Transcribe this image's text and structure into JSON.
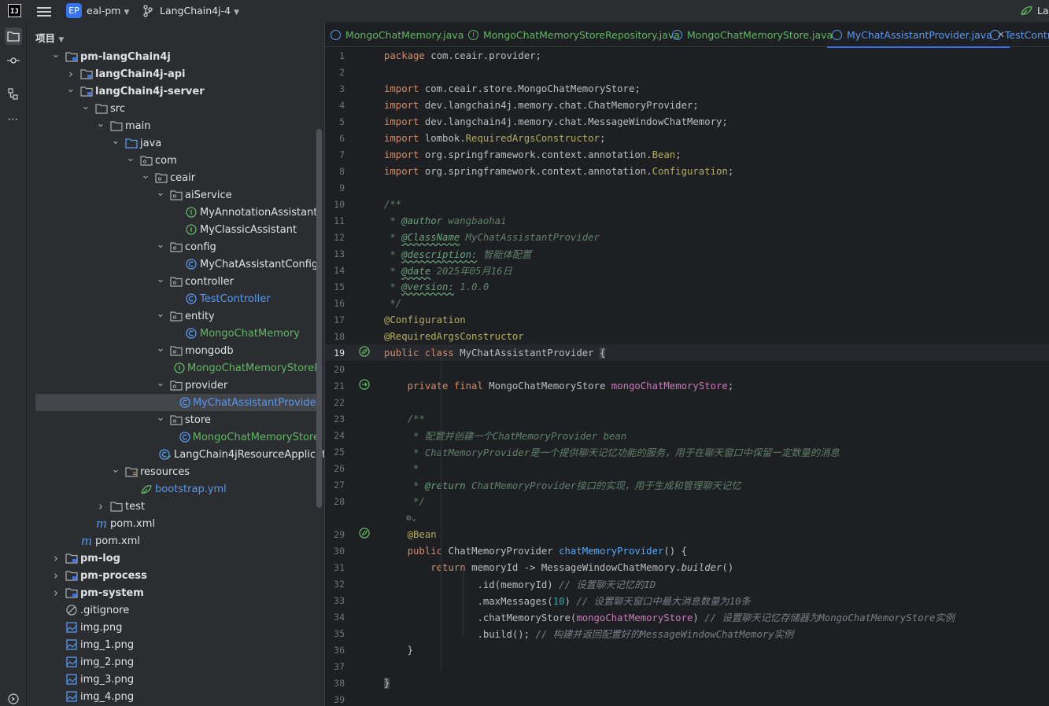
{
  "titlebar": {
    "logo": "IJ",
    "project_badge": "EP",
    "project_name": "eal-pm",
    "branch": "LangChain4j-4",
    "right_label": "Lar"
  },
  "project_panel": {
    "title": "项目",
    "tree": [
      {
        "label": "pm-langChain4j",
        "depth": 1,
        "chev": "down",
        "icon": "module-folder-icon",
        "bold": true
      },
      {
        "label": "langChain4j-api",
        "depth": 2,
        "chev": "right",
        "icon": "module-folder-icon",
        "bold": true
      },
      {
        "label": "langChain4j-server",
        "depth": 2,
        "chev": "down",
        "icon": "module-folder-icon",
        "bold": true
      },
      {
        "label": "src",
        "depth": 3,
        "chev": "down",
        "icon": "folder-icon"
      },
      {
        "label": "main",
        "depth": 4,
        "chev": "down",
        "icon": "folder-icon"
      },
      {
        "label": "java",
        "depth": 5,
        "chev": "down",
        "icon": "source-folder-icon"
      },
      {
        "label": "com",
        "depth": 6,
        "chev": "down",
        "icon": "package-icon"
      },
      {
        "label": "ceair",
        "depth": 7,
        "chev": "down",
        "icon": "package-icon"
      },
      {
        "label": "aiService",
        "depth": 8,
        "chev": "down",
        "icon": "package-icon"
      },
      {
        "label": "MyAnnotationAssistant",
        "depth": 9,
        "chev": "",
        "icon": "interface-icon"
      },
      {
        "label": "MyClassicAssistant",
        "depth": 9,
        "chev": "",
        "icon": "interface-icon"
      },
      {
        "label": "config",
        "depth": 8,
        "chev": "down",
        "icon": "package-icon"
      },
      {
        "label": "MyChatAssistantConfig",
        "depth": 9,
        "chev": "",
        "icon": "class-icon"
      },
      {
        "label": "controller",
        "depth": 8,
        "chev": "down",
        "icon": "package-icon"
      },
      {
        "label": "TestController",
        "depth": 9,
        "chev": "",
        "icon": "class-icon",
        "color": "blue"
      },
      {
        "label": "entity",
        "depth": 8,
        "chev": "down",
        "icon": "package-icon"
      },
      {
        "label": "MongoChatMemory",
        "depth": 9,
        "chev": "",
        "icon": "class-icon",
        "color": "green"
      },
      {
        "label": "mongodb",
        "depth": 8,
        "chev": "down",
        "icon": "package-icon"
      },
      {
        "label": "MongoChatMemoryStoreR",
        "depth": 9,
        "chev": "",
        "icon": "interface-icon",
        "color": "green"
      },
      {
        "label": "provider",
        "depth": 8,
        "chev": "down",
        "icon": "package-icon"
      },
      {
        "label": "MyChatAssistantProvider",
        "depth": 9,
        "chev": "",
        "icon": "class-icon",
        "color": "blue",
        "selected": true
      },
      {
        "label": "store",
        "depth": 8,
        "chev": "down",
        "icon": "package-icon"
      },
      {
        "label": "MongoChatMemoryStore",
        "depth": 9,
        "chev": "",
        "icon": "class-icon",
        "color": "green"
      },
      {
        "label": "LangChain4jResourceApplicati",
        "depth": 8,
        "chev": "",
        "icon": "spring-class-icon"
      },
      {
        "label": "resources",
        "depth": 5,
        "chev": "down",
        "icon": "resources-folder-icon"
      },
      {
        "label": "bootstrap.yml",
        "depth": 6,
        "chev": "",
        "icon": "spring-config-icon",
        "color": "blue"
      },
      {
        "label": "test",
        "depth": 4,
        "chev": "right",
        "icon": "folder-icon"
      },
      {
        "label": "pom.xml",
        "depth": 3,
        "chev": "",
        "icon": "maven-icon"
      },
      {
        "label": "pom.xml",
        "depth": 2,
        "chev": "",
        "icon": "maven-icon"
      },
      {
        "label": "pm-log",
        "depth": 1,
        "chev": "right",
        "icon": "module-folder-icon",
        "bold": true
      },
      {
        "label": "pm-process",
        "depth": 1,
        "chev": "right",
        "icon": "module-folder-icon",
        "bold": true
      },
      {
        "label": "pm-system",
        "depth": 1,
        "chev": "right",
        "icon": "module-folder-icon",
        "bold": true
      },
      {
        "label": ".gitignore",
        "depth": 1,
        "chev": "",
        "icon": "ignore-file-icon"
      },
      {
        "label": "img.png",
        "depth": 1,
        "chev": "",
        "icon": "image-file-icon"
      },
      {
        "label": "img_1.png",
        "depth": 1,
        "chev": "",
        "icon": "image-file-icon"
      },
      {
        "label": "img_2.png",
        "depth": 1,
        "chev": "",
        "icon": "image-file-icon"
      },
      {
        "label": "img_3.png",
        "depth": 1,
        "chev": "",
        "icon": "image-file-icon"
      },
      {
        "label": "img_4.png",
        "depth": 1,
        "chev": "",
        "icon": "image-file-icon"
      }
    ]
  },
  "tabs": [
    {
      "label": "MongoChatMemory.java",
      "icon": "class-icon"
    },
    {
      "label": "MongoChatMemoryStoreRepository.java",
      "icon": "interface-icon"
    },
    {
      "label": "MongoChatMemoryStore.java",
      "icon": "class-icon"
    },
    {
      "label": "MyChatAssistantProvider.java",
      "icon": "class-icon",
      "active": true
    },
    {
      "label": "TestContro",
      "icon": "class-icon"
    }
  ],
  "editor": {
    "current_line": 19,
    "lines": [
      [
        [
          "kw",
          "package "
        ],
        [
          "txt",
          "com.ceair.provider;"
        ]
      ],
      [],
      [
        [
          "kw",
          "import "
        ],
        [
          "txt",
          "com.ceair.store.MongoChatMemoryStore;"
        ]
      ],
      [
        [
          "kw",
          "import "
        ],
        [
          "txt",
          "dev.langchain4j.memory.chat.ChatMemoryProvider;"
        ]
      ],
      [
        [
          "kw",
          "import "
        ],
        [
          "txt",
          "dev.langchain4j.memory.chat.MessageWindowChatMemory;"
        ]
      ],
      [
        [
          "kw",
          "import "
        ],
        [
          "txt",
          "lombok."
        ],
        [
          "ann",
          "RequiredArgsConstructor"
        ],
        [
          "txt",
          ";"
        ]
      ],
      [
        [
          "kw",
          "import "
        ],
        [
          "txt",
          "org.springframework.context.annotation."
        ],
        [
          "ann",
          "Bean"
        ],
        [
          "txt",
          ";"
        ]
      ],
      [
        [
          "kw",
          "import "
        ],
        [
          "txt",
          "org.springframework.context.annotation."
        ],
        [
          "ann",
          "Configuration"
        ],
        [
          "txt",
          ";"
        ]
      ],
      [],
      [
        [
          "doc",
          "/**"
        ]
      ],
      [
        [
          "doc",
          " * "
        ],
        [
          "doctag2",
          "@author"
        ],
        [
          "doc",
          " wangbaohai"
        ]
      ],
      [
        [
          "doc",
          " * "
        ],
        [
          "doctag",
          "@ClassName"
        ],
        [
          "doc",
          " MyChatAssistantProvider"
        ]
      ],
      [
        [
          "doc",
          " * "
        ],
        [
          "doctag",
          "@description:"
        ],
        [
          "doc",
          " 智能体配置"
        ]
      ],
      [
        [
          "doc",
          " * "
        ],
        [
          "doctag",
          "@date"
        ],
        [
          "doc",
          " 2025年05月16日"
        ]
      ],
      [
        [
          "doc",
          " * "
        ],
        [
          "doctag",
          "@version:"
        ],
        [
          "doc",
          " 1.0.0"
        ]
      ],
      [
        [
          "doc",
          " */"
        ]
      ],
      [
        [
          "ann",
          "@Configuration"
        ]
      ],
      [
        [
          "ann",
          "@RequiredArgsConstructor"
        ]
      ],
      [
        [
          "kw",
          "public class "
        ],
        [
          "txt",
          "MyChatAssistantProvider "
        ],
        [
          "brace",
          "{"
        ]
      ],
      [],
      [
        [
          "txt",
          "    "
        ],
        [
          "kw",
          "private final "
        ],
        [
          "txt",
          "MongoChatMemoryStore "
        ],
        [
          "fld",
          "mongoChatMemoryStore"
        ],
        [
          "txt",
          ";"
        ]
      ],
      [],
      [
        [
          "txt",
          "    "
        ],
        [
          "doc",
          "/**"
        ]
      ],
      [
        [
          "txt",
          "    "
        ],
        [
          "doc",
          " * 配置并创建一个ChatMemoryProvider bean"
        ]
      ],
      [
        [
          "txt",
          "    "
        ],
        [
          "doc",
          " * ChatMemoryProvider是一个提供聊天记忆功能的服务，用于在聊天窗口中保留一定数量的消息"
        ]
      ],
      [
        [
          "txt",
          "    "
        ],
        [
          "doc",
          " *"
        ]
      ],
      [
        [
          "txt",
          "    "
        ],
        [
          "doc",
          " * "
        ],
        [
          "doctag2",
          "@return"
        ],
        [
          "doc",
          " ChatMemoryProvider接口的实现，用于生成和管理聊天记忆"
        ]
      ],
      [
        [
          "txt",
          "    "
        ],
        [
          "doc",
          " */"
        ]
      ],
      [
        [
          "txt",
          "    "
        ],
        [
          "ann",
          "@Bean"
        ]
      ],
      [
        [
          "txt",
          "    "
        ],
        [
          "kw",
          "public "
        ],
        [
          "txt",
          "ChatMemoryProvider "
        ],
        [
          "mth",
          "chatMemoryProvider"
        ],
        [
          "txt",
          "() {"
        ]
      ],
      [
        [
          "txt",
          "        "
        ],
        [
          "kw",
          "return "
        ],
        [
          "txt",
          "memoryId -> MessageWindowChatMemory."
        ],
        [
          "stat",
          "builder"
        ],
        [
          "txt",
          "()"
        ]
      ],
      [
        [
          "txt",
          "                .id(memoryId) "
        ],
        [
          "cm",
          "// 设置聊天记忆的ID"
        ]
      ],
      [
        [
          "txt",
          "                .maxMessages("
        ],
        [
          "num",
          "10"
        ],
        [
          "txt",
          ") "
        ],
        [
          "cm",
          "// 设置聊天窗口中最大消息数量为10条"
        ]
      ],
      [
        [
          "txt",
          "                .chatMemoryStore("
        ],
        [
          "fld",
          "mongoChatMemoryStore"
        ],
        [
          "txt",
          ") "
        ],
        [
          "cm",
          "// 设置聊天记忆存储器为MongoChatMemoryStore实例"
        ]
      ],
      [
        [
          "txt",
          "                .build(); "
        ],
        [
          "cm",
          "// 构建并返回配置好的MessageWindowChatMemory实例"
        ]
      ],
      [
        [
          "txt",
          "    }"
        ]
      ],
      [],
      [
        [
          "brace",
          "}"
        ]
      ],
      []
    ],
    "line_numbers": [
      "1",
      "2",
      "3",
      "4",
      "5",
      "6",
      "7",
      "8",
      "9",
      "10",
      "11",
      "12",
      "13",
      "14",
      "15",
      "16",
      "17",
      "18",
      "19",
      "20",
      "21",
      "22",
      "23",
      "24",
      "25",
      "26",
      "27",
      "28",
      "",
      "29",
      "30",
      "31",
      "32",
      "33",
      "34",
      "35",
      "36",
      "37",
      "38",
      "39"
    ]
  },
  "colors": {
    "accent": "#3574f0",
    "keyword": "#cf8e6d",
    "annotation": "#b3ae60",
    "doc": "#5f826b",
    "field": "#c77dbb",
    "method": "#56a8f5",
    "number": "#2aacb8"
  }
}
